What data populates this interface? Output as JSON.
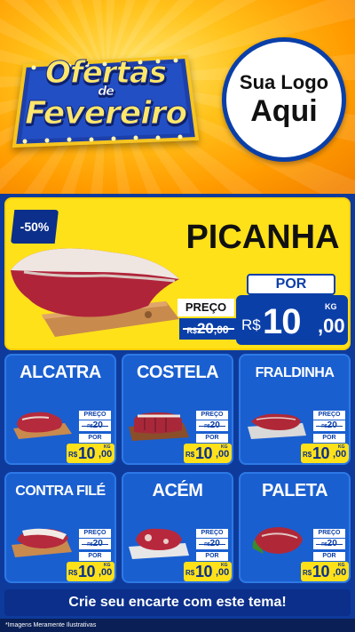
{
  "header": {
    "badge_line1": "Ofertas",
    "badge_line2": "de",
    "badge_line3": "Fevereiro",
    "logo_line1": "Sua Logo",
    "logo_line2": "Aqui"
  },
  "hero": {
    "discount": "-50%",
    "name": "PICANHA",
    "por_label": "POR",
    "preco_label": "PREÇO",
    "old_currency": "R$",
    "old_int": "20",
    "old_dec": ",00",
    "currency": "R$",
    "price_int": "10",
    "price_dec": ",00",
    "unit": "KG"
  },
  "labels": {
    "preco": "PREÇO",
    "por": "POR",
    "currency": "R$",
    "unit": "KG",
    "old_price": "20",
    "price_int": "10",
    "price_dec": ",00"
  },
  "products": [
    {
      "name": "ALCATRA"
    },
    {
      "name": "COSTELA"
    },
    {
      "name": "FRALDINHA"
    },
    {
      "name": "CONTRA FILÉ"
    },
    {
      "name": "ACÉM"
    },
    {
      "name": "PALETA"
    }
  ],
  "footer": {
    "cta": "Crie seu encarte com este tema!",
    "disclaimer": "*Imagens Meramente Ilustrativas"
  },
  "colors": {
    "header_orange": "#ffb000",
    "brand_blue": "#0b3fa8",
    "card_blue": "#1a5fd0",
    "hero_yellow": "#ffe11a"
  }
}
